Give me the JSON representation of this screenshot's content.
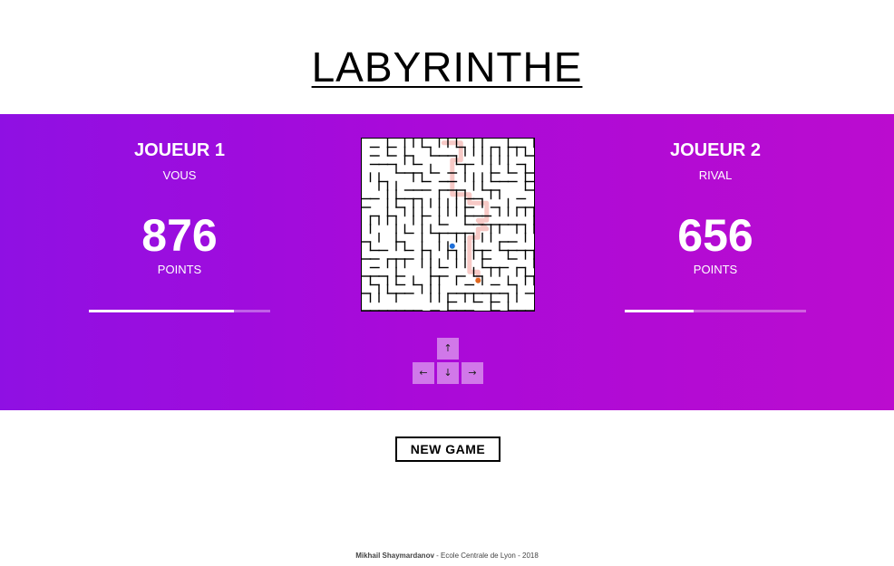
{
  "title": "LABYRINTHE",
  "player1": {
    "name": "JOUEUR 1",
    "role": "VOUS",
    "score": "876",
    "units": "POINTS",
    "progress": 0.8
  },
  "player2": {
    "name": "JOUEUR 2",
    "role": "RIVAL",
    "score": "656",
    "units": "POINTS",
    "progress": 0.38
  },
  "maze": {
    "grid_size": 20,
    "path_color": "#f7c9c6",
    "player1_marker_color": "#1e6fd9",
    "player2_marker_color": "#e0671e"
  },
  "controls": {
    "up": "↑",
    "left": "←",
    "down": "↓",
    "right": "→"
  },
  "new_game_label": "NEW GAME",
  "footer": {
    "author": "Mikhail Shaymardanov",
    "rest": " - Ecole Centrale de Lyon - 2018"
  }
}
